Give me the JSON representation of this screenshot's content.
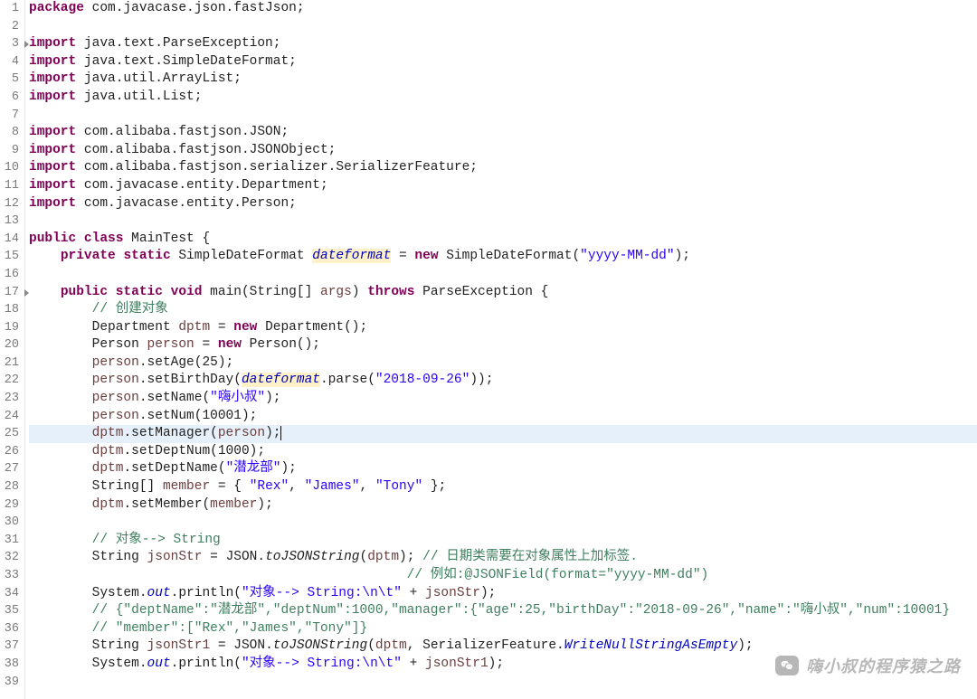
{
  "lineNumbers": [
    "1",
    "2",
    "3",
    "4",
    "5",
    "6",
    "7",
    "8",
    "9",
    "10",
    "11",
    "12",
    "13",
    "14",
    "15",
    "16",
    "17",
    "18",
    "19",
    "20",
    "21",
    "22",
    "23",
    "24",
    "25",
    "26",
    "27",
    "28",
    "29",
    "30",
    "31",
    "32",
    "33",
    "34",
    "35",
    "36",
    "37",
    "38",
    "39"
  ],
  "foldLines": [
    3,
    17
  ],
  "currentLine": 25,
  "code": {
    "l1": {
      "kw": "package",
      "rest": " com.javacase.json.fastJson;"
    },
    "l3": {
      "kw": "import",
      "rest": " java.text.ParseException;"
    },
    "l4": {
      "kw": "import",
      "rest": " java.text.SimpleDateFormat;"
    },
    "l5": {
      "kw": "import",
      "rest": " java.util.ArrayList;"
    },
    "l6": {
      "kw": "import",
      "rest": " java.util.List;"
    },
    "l8": {
      "kw": "import",
      "rest": " com.alibaba.fastjson.JSON;"
    },
    "l9": {
      "kw": "import",
      "rest": " com.alibaba.fastjson.JSONObject;"
    },
    "l10": {
      "kw": "import",
      "rest": " com.alibaba.fastjson.serializer.SerializerFeature;"
    },
    "l11": {
      "kw": "import",
      "rest": " com.javacase.entity.Department;"
    },
    "l12": {
      "kw": "import",
      "rest": " com.javacase.entity.Person;"
    },
    "l14": {
      "p1": "public",
      "p2": "class",
      "name": " MainTest {"
    },
    "l15": {
      "ind": "    ",
      "p1": "private",
      "p2": "static",
      "type": " SimpleDateFormat ",
      "fld": "dateformat",
      "eq": " = ",
      "nw": "new",
      "rest": " SimpleDateFormat(",
      "str": "\"yyyy-MM-dd\"",
      "end": ");"
    },
    "l17": {
      "ind": "    ",
      "p1": "public",
      "p2": "static",
      "p3": "void",
      "sig1": " main(String[] ",
      "arg": "args",
      "sig2": ") ",
      "thr": "throws",
      "exc": " ParseException {"
    },
    "l18": {
      "ind": "        ",
      "cmt": "// 创建对象"
    },
    "l19": {
      "ind": "        ",
      "t": "Department ",
      "v": "dptm",
      "eq": " = ",
      "nw": "new",
      "rest": " Department();"
    },
    "l20": {
      "ind": "        ",
      "t": "Person ",
      "v": "person",
      "eq": " = ",
      "nw": "new",
      "rest": " Person();"
    },
    "l21": {
      "ind": "        ",
      "v": "person",
      "rest": ".setAge(25);"
    },
    "l22": {
      "ind": "        ",
      "v": "person",
      "m1": ".setBirthDay(",
      "fld": "dateformat",
      "m2": ".parse(",
      "str": "\"2018-09-26\"",
      "end": "));"
    },
    "l23": {
      "ind": "        ",
      "v": "person",
      "m": ".setName(",
      "str": "\"嗨小叔\"",
      "end": ");"
    },
    "l24": {
      "ind": "        ",
      "v": "person",
      "rest": ".setNum(10001);"
    },
    "l25": {
      "ind": "        ",
      "v": "dptm",
      "m": ".setManager(",
      "arg": "person",
      "end": ");"
    },
    "l26": {
      "ind": "        ",
      "v": "dptm",
      "rest": ".setDeptNum(1000);"
    },
    "l27": {
      "ind": "        ",
      "v": "dptm",
      "m": ".setDeptName(",
      "str": "\"潜龙部\"",
      "end": ");"
    },
    "l28": {
      "ind": "        ",
      "t": "String[] ",
      "v": "member",
      "eq": " = { ",
      "s1": "\"Rex\"",
      "c1": ", ",
      "s2": "\"James\"",
      "c2": ", ",
      "s3": "\"Tony\"",
      "end": " };"
    },
    "l29": {
      "ind": "        ",
      "v": "dptm",
      "m": ".setMember(",
      "arg": "member",
      "end": ");"
    },
    "l31": {
      "ind": "        ",
      "cmt": "// 对象--> String"
    },
    "l32": {
      "ind": "        ",
      "t": "String ",
      "v": "jsonStr",
      "eq": " = JSON.",
      "fn": "toJSONString",
      "args": "(",
      "arg": "dptm",
      "end": "); ",
      "cmt": "// 日期类需要在对象属性上加标签."
    },
    "l33": {
      "ind": "                                                ",
      "cmt": "// 例如:@JSONField(format=\"yyyy-MM-dd\")"
    },
    "l34": {
      "ind": "        ",
      "pre": "System.",
      "out": "out",
      "m": ".println(",
      "str": "\"对象--> String:\\n\\t\"",
      "plus": " + ",
      "v": "jsonStr",
      "end": ");"
    },
    "l35": {
      "ind": "        ",
      "cmt": "// {\"deptName\":\"潜龙部\",\"deptNum\":1000,\"manager\":{\"age\":25,\"birthDay\":\"2018-09-26\",\"name\":\"嗨小叔\",\"num\":10001}"
    },
    "l36": {
      "ind": "        ",
      "cmt": "// \"member\":[\"Rex\",\"James\",\"Tony\"]}"
    },
    "l37": {
      "ind": "        ",
      "t": "String ",
      "v": "jsonStr1",
      "eq": " = JSON.",
      "fn": "toJSONString",
      "args": "(",
      "arg": "dptm",
      "c": ", SerializerFeature.",
      "fld": "WriteNullStringAsEmpty",
      "end": ");"
    },
    "l38": {
      "ind": "        ",
      "pre": "System.",
      "out": "out",
      "m": ".println(",
      "str": "\"对象--> String:\\n\\t\"",
      "plus": " + ",
      "v": "jsonStr1",
      "end": ");"
    }
  },
  "watermark": "嗨小叔的程序猿之路"
}
